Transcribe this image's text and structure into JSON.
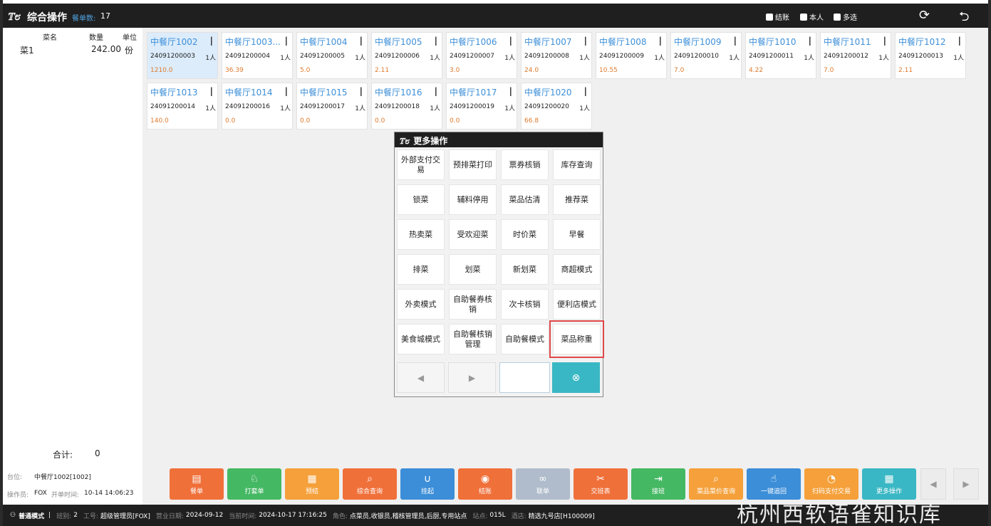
{
  "header": {
    "logo": "𝕋೮",
    "title": "综合操作",
    "count_label": "餐单数:",
    "count": "17",
    "checks": [
      "结账",
      "本人",
      "多选"
    ]
  },
  "left": {
    "col_name": "菜名",
    "col_qty": "数量",
    "col_unit": "单位",
    "item_name": "菜1",
    "item_qty": "242.00",
    "item_unit": "份",
    "total_label": "合计:",
    "total": "0"
  },
  "tables": [
    {
      "name": "中餐厅1002",
      "no": "24091200003",
      "people": "1人",
      "amount": "1210.0"
    },
    {
      "name": "中餐厅1003...",
      "no": "24091200004",
      "people": "1人",
      "amount": "36.39"
    },
    {
      "name": "中餐厅1004",
      "no": "24091200005",
      "people": "1人",
      "amount": "5.0"
    },
    {
      "name": "中餐厅1005",
      "no": "24091200006",
      "people": "1人",
      "amount": "2.11"
    },
    {
      "name": "中餐厅1006",
      "no": "24091200007",
      "people": "1人",
      "amount": "3.0"
    },
    {
      "name": "中餐厅1007",
      "no": "24091200008",
      "people": "1人",
      "amount": "24.0"
    },
    {
      "name": "中餐厅1008",
      "no": "24091200009",
      "people": "1人",
      "amount": "10.55"
    },
    {
      "name": "中餐厅1009",
      "no": "24091200010",
      "people": "1人",
      "amount": "7.0"
    },
    {
      "name": "中餐厅1010",
      "no": "24091200011",
      "people": "1人",
      "amount": "4.22"
    },
    {
      "name": "中餐厅1011",
      "no": "24091200012",
      "people": "1人",
      "amount": "7.0"
    },
    {
      "name": "中餐厅1012",
      "no": "24091200013",
      "people": "1人",
      "amount": "2.11"
    },
    {
      "name": "中餐厅1013",
      "no": "24091200014",
      "people": "1人",
      "amount": "140.0"
    },
    {
      "name": "中餐厅1014",
      "no": "24091200016",
      "people": "1人",
      "amount": "0.0"
    },
    {
      "name": "中餐厅1015",
      "no": "24091200017",
      "people": "1人",
      "amount": "0.0"
    },
    {
      "name": "中餐厅1016",
      "no": "24091200018",
      "people": "1人",
      "amount": "0.0"
    },
    {
      "name": "中餐厅1017",
      "no": "24091200019",
      "people": "1人",
      "amount": "0.0"
    },
    {
      "name": "中餐厅1020",
      "no": "24091200020",
      "people": "1人",
      "amount": "66.8"
    }
  ],
  "dialog": {
    "title": "更多操作",
    "buttons": [
      "外部支付交易",
      "预排菜打印",
      "票券核销",
      "库存查询",
      "锁菜",
      "辅料停用",
      "菜品估清",
      "推荐菜",
      "热卖菜",
      "受欢迎菜",
      "时价菜",
      "早餐",
      "排菜",
      "划菜",
      "新划菜",
      "商超模式",
      "外卖模式",
      "自助餐券核销",
      "次卡核销",
      "便利店模式",
      "美食城模式",
      "自助餐核销管理",
      "自助餐模式",
      "菜品称重"
    ],
    "prev": "◀",
    "next": "▶",
    "close": "⊗"
  },
  "info": {
    "table_label": "台位:",
    "table_value": "中餐厅1002[1002]",
    "op_label": "操作员:",
    "op_value": "FOX",
    "open_label": "开单时间:",
    "open_value": "10-14 14:06:23"
  },
  "toolbar": [
    {
      "label": "餐单",
      "icon": "▤",
      "color": "#f0703a"
    },
    {
      "label": "打套单",
      "icon": "♘",
      "color": "#45b864"
    },
    {
      "label": "预结",
      "icon": "▦",
      "color": "#f5a03a"
    },
    {
      "label": "综合查询",
      "icon": "⌕",
      "color": "#f0703a"
    },
    {
      "label": "挂起",
      "icon": "∪",
      "color": "#3c8ed8"
    },
    {
      "label": "结账",
      "icon": "◉",
      "color": "#f0703a"
    },
    {
      "label": "联单",
      "icon": "∞",
      "color": "#b0bccb"
    },
    {
      "label": "交班表",
      "icon": "✂",
      "color": "#f0703a"
    },
    {
      "label": "接班",
      "icon": "⇥",
      "color": "#45b864"
    },
    {
      "label": "菜品菜价查询",
      "icon": "⌕",
      "color": "#f5a03a"
    },
    {
      "label": "一键追回",
      "icon": "☝",
      "color": "#3c8ed8"
    },
    {
      "label": "扫码支付交易",
      "icon": "◔",
      "color": "#f5a03a"
    },
    {
      "label": "更多操作",
      "icon": "▦",
      "color": "#3ab7c4"
    }
  ],
  "status": {
    "mode": "普通模式",
    "shift_label": "班别:",
    "shift": "2",
    "worker_label": "工号:",
    "worker": "超级管理员[FOX]",
    "biz_label": "营业日期:",
    "biz_date": "2024-09-12",
    "now_label": "当前时间:",
    "now": "2024-10-17 17:16:25",
    "role_label": "角色:",
    "role": "点菜员,收银员,稽核管理员,后厨,专用站点",
    "site_label": "站点:",
    "site": "015L",
    "store_label": "酒店:",
    "store": "精选九号店[H100009]"
  },
  "watermark": "杭州西软语雀知识库"
}
